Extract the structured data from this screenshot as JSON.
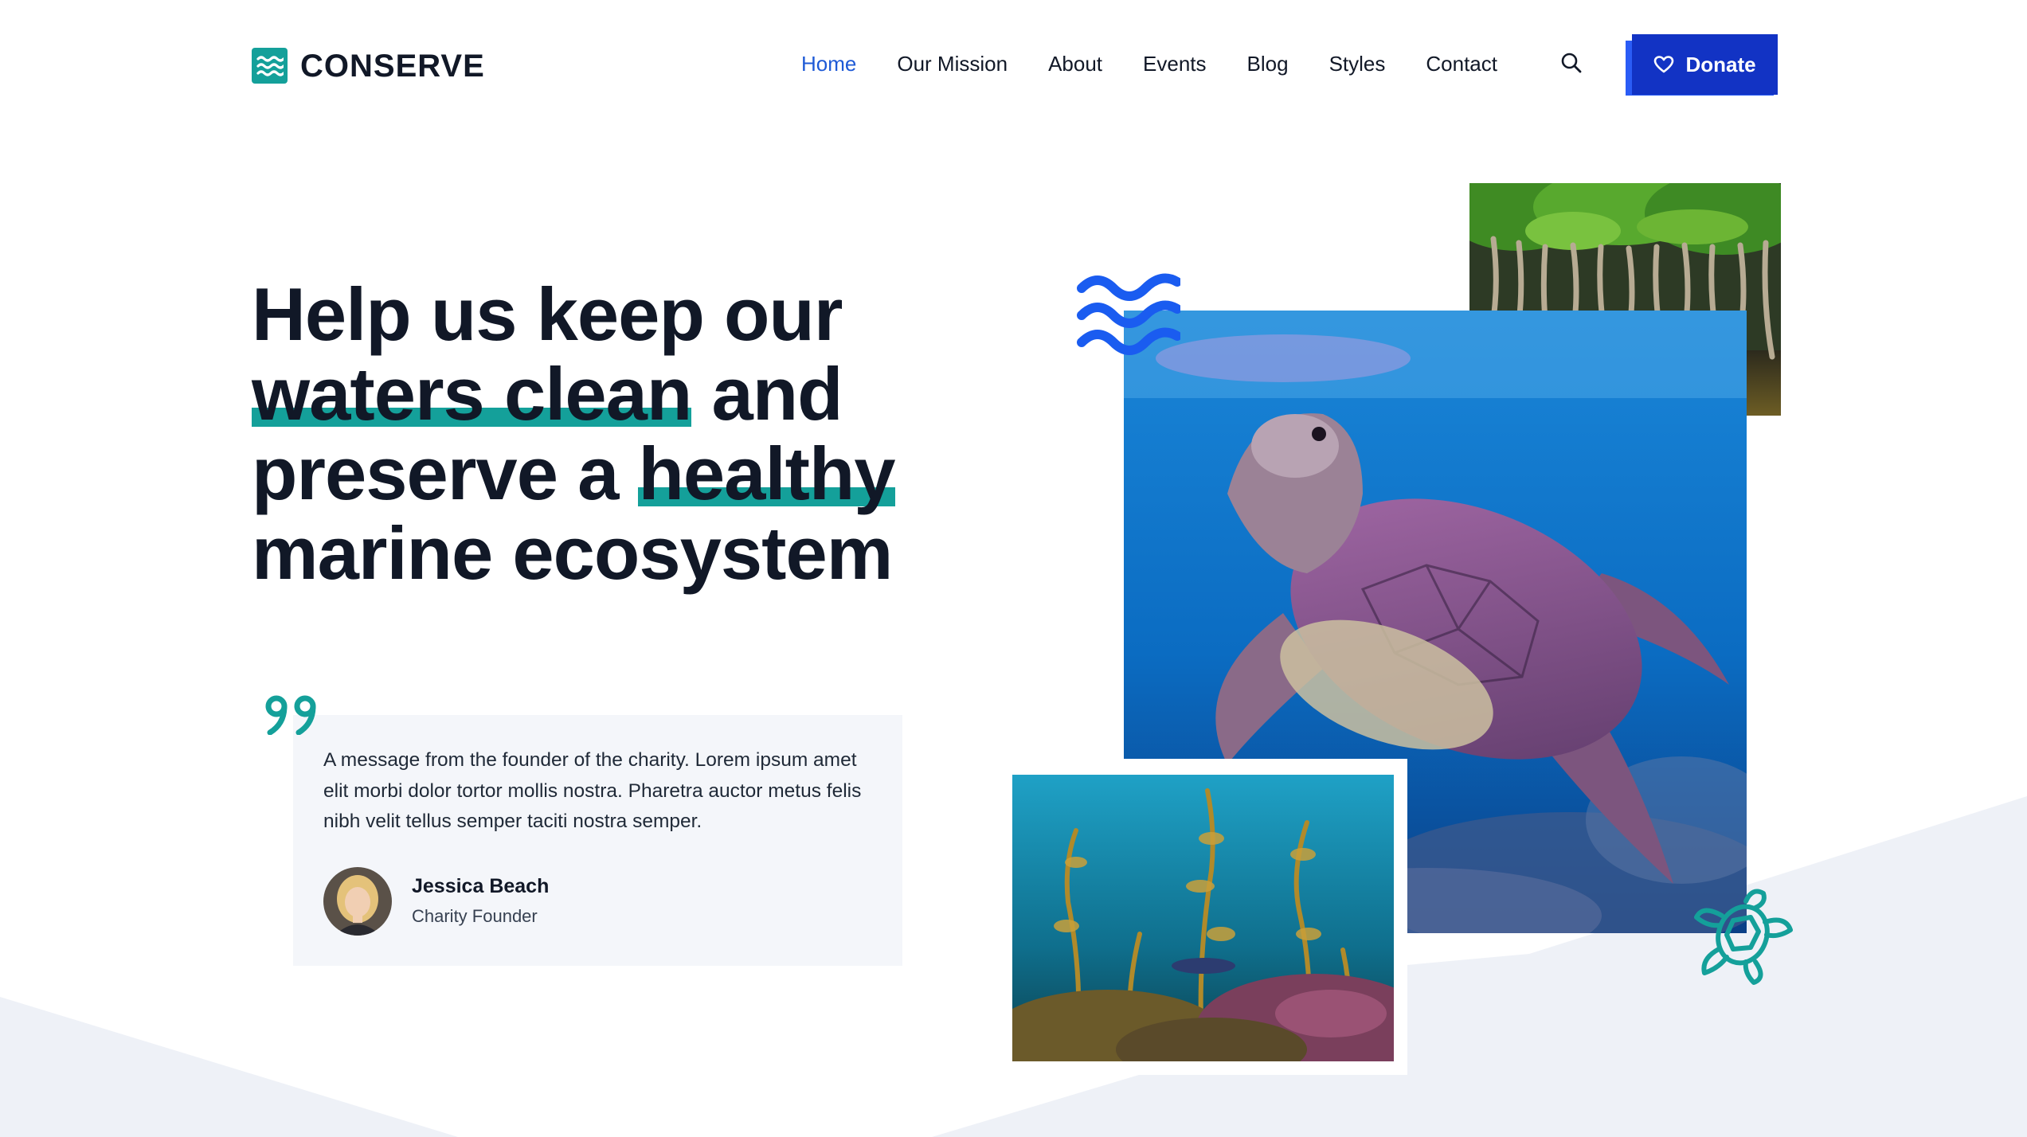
{
  "brand": {
    "name": "CONSERVE",
    "accent": "#14a09a",
    "logo_icon": "waves-icon"
  },
  "nav": {
    "items": [
      {
        "label": "Home",
        "active": true
      },
      {
        "label": "Our Mission"
      },
      {
        "label": "About"
      },
      {
        "label": "Events"
      },
      {
        "label": "Blog"
      },
      {
        "label": "Styles"
      },
      {
        "label": "Contact"
      }
    ],
    "search_icon": "search-icon",
    "active_color": "#1e5ad6"
  },
  "donate": {
    "label": "Donate",
    "icon": "heart-icon",
    "color": "#1233c4",
    "shadow_color": "#2a5cf6"
  },
  "hero": {
    "line1": "Help us keep our",
    "line2_highlight": "waters clean",
    "line2_rest": " and",
    "line3_start": "preserve a ",
    "line3_highlight": "healthy",
    "line4": "marine ecosystem"
  },
  "quote": {
    "text": "A message from the founder of the charity. Lorem ipsum amet elit morbi dolor tortor mollis nostra. Pharetra auctor metus felis nibh velit tellus semper taciti nostra semper.",
    "author_name": "Jessica Beach",
    "author_role": "Charity Founder",
    "icon": "quote-icon"
  },
  "decor": {
    "waves_color": "#1a5cf0",
    "turtle_outline_color": "#14a09a",
    "background_shape_color": "#eef1f7"
  }
}
